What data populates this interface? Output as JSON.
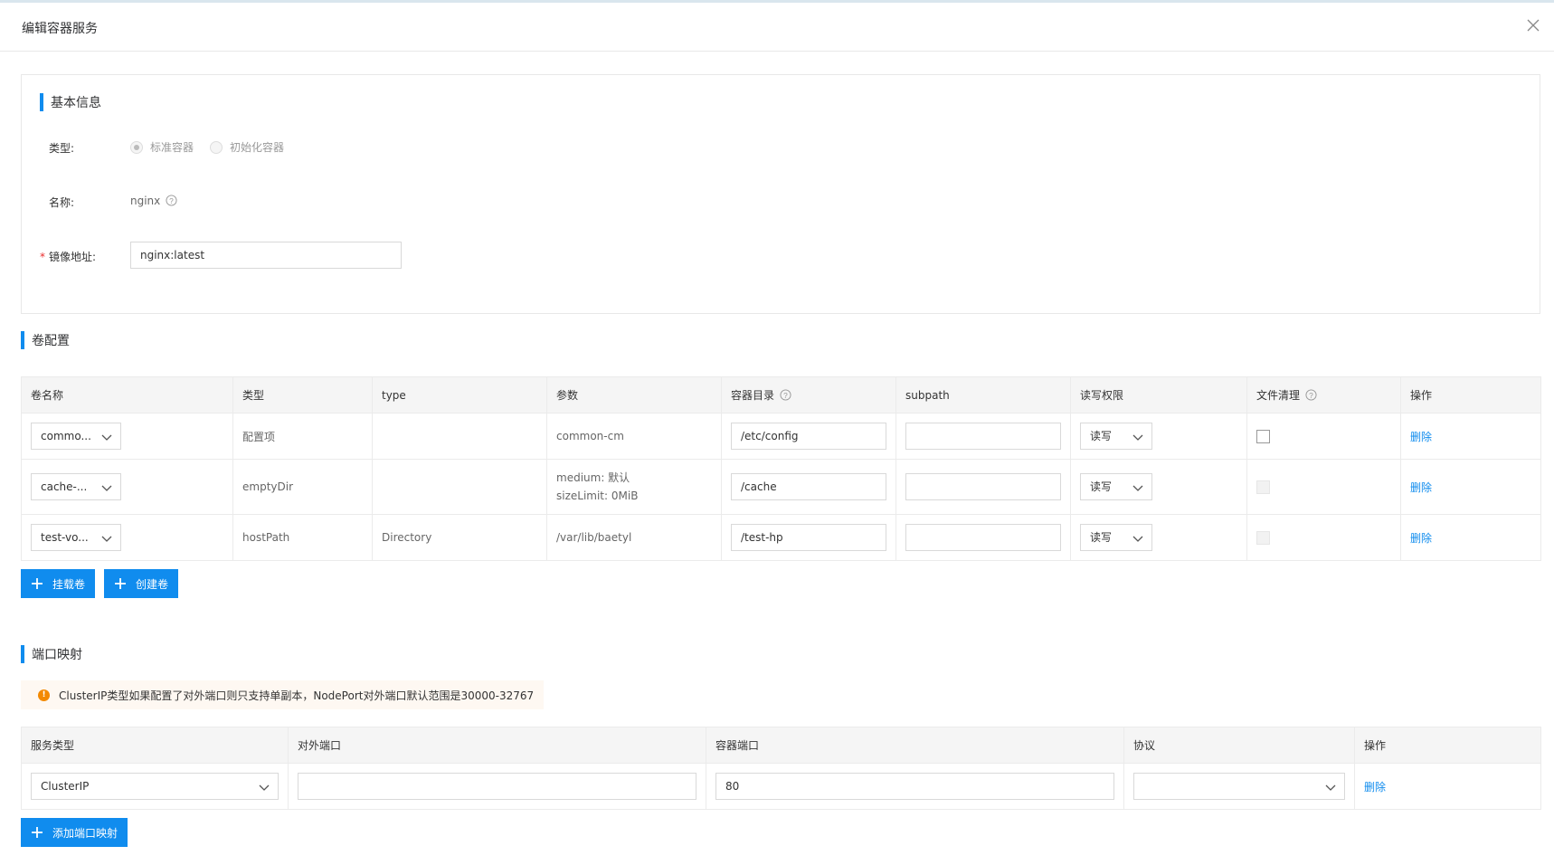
{
  "dialog": {
    "title": "编辑容器服务"
  },
  "basic": {
    "section_title": "基本信息",
    "type_label": "类型:",
    "type_options": [
      "标准容器",
      "初始化容器"
    ],
    "type_selected": "标准容器",
    "name_label": "名称:",
    "name_value": "nginx",
    "image_label": "镜像地址:",
    "image_required_mark": "*",
    "image_value": "nginx:latest"
  },
  "volumes": {
    "section_title": "卷配置",
    "headers": [
      "卷名称",
      "类型",
      "type",
      "参数",
      "容器目录",
      "subpath",
      "读写权限",
      "文件清理",
      "操作"
    ],
    "rows": [
      {
        "name": "commo...",
        "kind": "配置项",
        "type": "",
        "param1": "common-cm",
        "param2": "",
        "mount": "/etc/config",
        "subpath": "",
        "perm": "读写",
        "cleanup_enabled": true,
        "cleanup_checked": false,
        "action": "删除"
      },
      {
        "name": "cache-...",
        "kind": "emptyDir",
        "type": "",
        "param1": "medium: 默认",
        "param2": "sizeLimit: 0MiB",
        "mount": "/cache",
        "subpath": "",
        "perm": "读写",
        "cleanup_enabled": false,
        "cleanup_checked": false,
        "action": "删除"
      },
      {
        "name": "test-vo...",
        "kind": "hostPath",
        "type": "Directory",
        "param1": "/var/lib/baetyl",
        "param2": "",
        "mount": "/test-hp",
        "subpath": "",
        "perm": "读写",
        "cleanup_enabled": false,
        "cleanup_checked": false,
        "action": "删除"
      }
    ],
    "mount_button": "挂载卷",
    "create_button": "创建卷"
  },
  "ports": {
    "section_title": "端口映射",
    "notice": "ClusterIP类型如果配置了对外端口则只支持单副本，NodePort对外端口默认范围是30000-32767",
    "headers": [
      "服务类型",
      "对外端口",
      "容器端口",
      "协议",
      "操作"
    ],
    "rows": [
      {
        "service_type": "ClusterIP",
        "external_port": "",
        "container_port": "80",
        "protocol": "",
        "action": "删除"
      }
    ],
    "add_button": "添加端口映射"
  },
  "colors": {
    "accent": "#108cee",
    "warning": "#f38900",
    "danger": "#ea2e2e"
  }
}
